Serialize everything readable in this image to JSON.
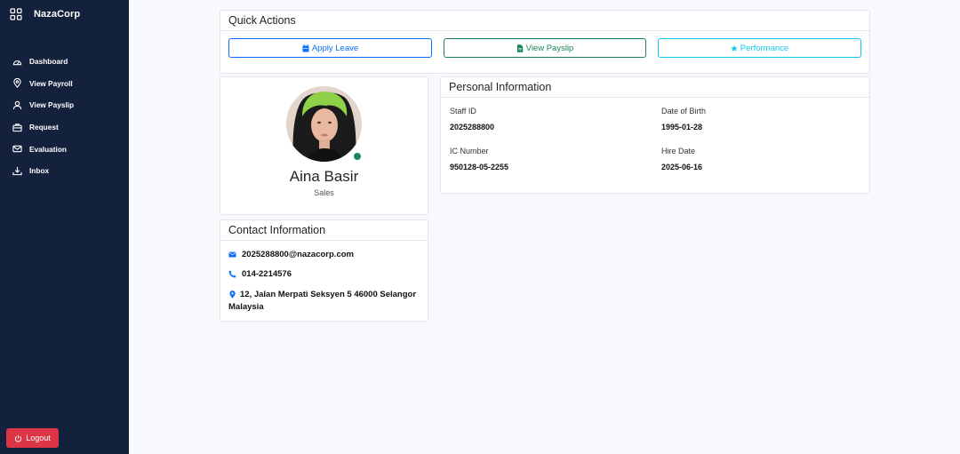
{
  "sidebar": {
    "brand": "NazaCorp",
    "items": [
      {
        "label": "Dashboard",
        "icon": "dashboard-icon"
      },
      {
        "label": "View Payroll",
        "icon": "map-pin-icon"
      },
      {
        "label": "View Payslip",
        "icon": "user-icon"
      },
      {
        "label": "Request",
        "icon": "briefcase-icon"
      },
      {
        "label": "Evaluation",
        "icon": "envelope-icon"
      },
      {
        "label": "Inbox",
        "icon": "inbox-download-icon"
      }
    ],
    "logout_label": "Logout"
  },
  "quick_actions": {
    "title": "Quick Actions",
    "buttons": [
      {
        "label": "Apply Leave",
        "icon": "calendar-icon"
      },
      {
        "label": "View Payslip",
        "icon": "file-icon"
      },
      {
        "label": "Performance",
        "icon": "star-icon"
      }
    ]
  },
  "profile": {
    "name": "Aina Basir",
    "department": "Sales",
    "status": "online"
  },
  "personal_info": {
    "title": "Personal Information",
    "fields": [
      {
        "label": "Staff ID",
        "value": "2025288800"
      },
      {
        "label": "Date of Birth",
        "value": "1995-01-28"
      },
      {
        "label": "IC Number",
        "value": "950128-05-2255"
      },
      {
        "label": "Hire Date",
        "value": "2025-06-16"
      }
    ]
  },
  "contact_info": {
    "title": "Contact Information",
    "email": "2025288800@nazacorp.com",
    "phone": "014-2214576",
    "address": "12, Jalan Merpati Seksyen 5 46000 Selangor Malaysia"
  },
  "colors": {
    "sidebar_bg": "#14213d",
    "primary": "#0d6efd",
    "success": "#198754",
    "info": "#0dcaf0",
    "danger": "#dc3545"
  }
}
